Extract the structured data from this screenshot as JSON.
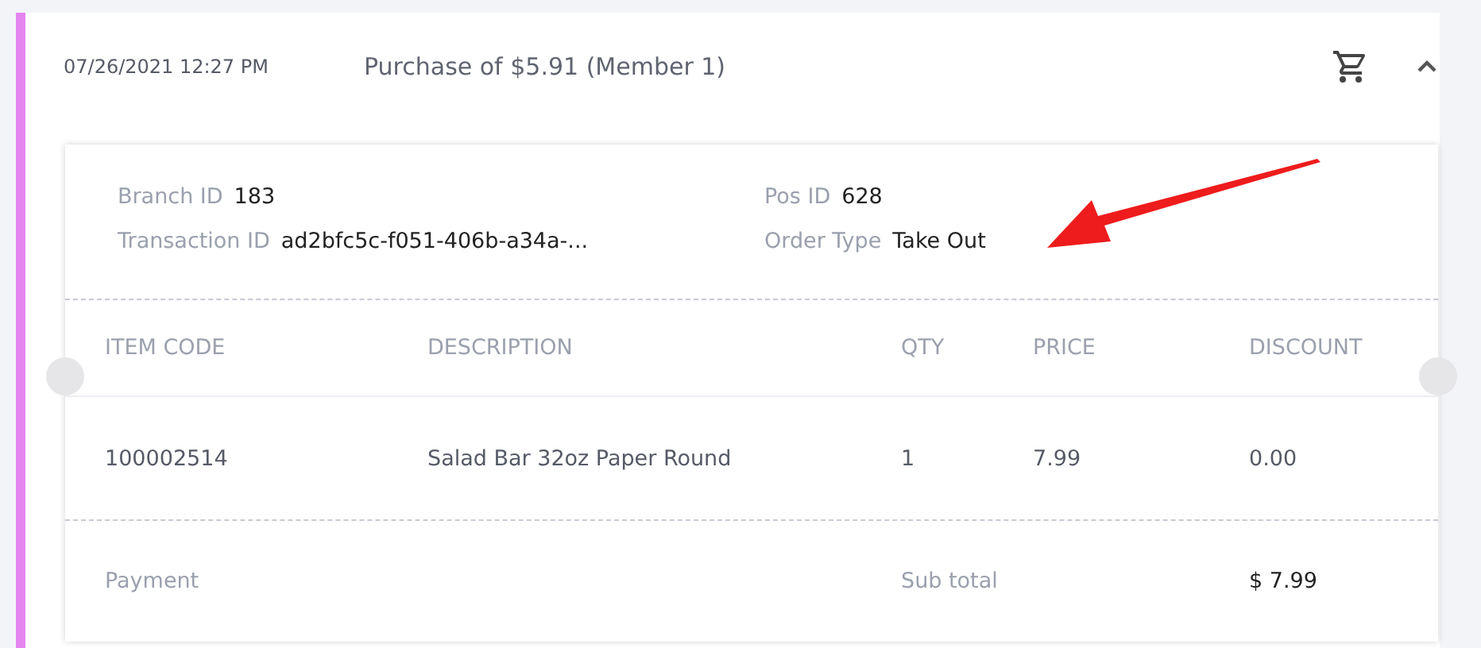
{
  "transaction": {
    "date": "07/26/2021 12:27 PM",
    "title": "Purchase of $5.91 (Member 1)",
    "expanded": true,
    "details": [
      {
        "label": "Branch ID",
        "value": "183"
      },
      {
        "label": "Pos ID",
        "value": "628"
      },
      {
        "label": "Transaction ID",
        "value": "ad2bfc5c-f051-406b-a34a-..."
      },
      {
        "label": "Order Type",
        "value": "Take Out"
      }
    ],
    "table": {
      "columns": [
        "ITEM CODE",
        "DESCRIPTION",
        "QTY",
        "PRICE",
        "DISCOUNT"
      ],
      "rows": [
        [
          "100002514",
          "Salad Bar 32oz Paper Round",
          "1",
          "7.99",
          "0.00"
        ]
      ]
    },
    "footer": {
      "payment_label": "Payment",
      "subtotal_label": "Sub total",
      "subtotal_value": "$ 7.99"
    }
  }
}
